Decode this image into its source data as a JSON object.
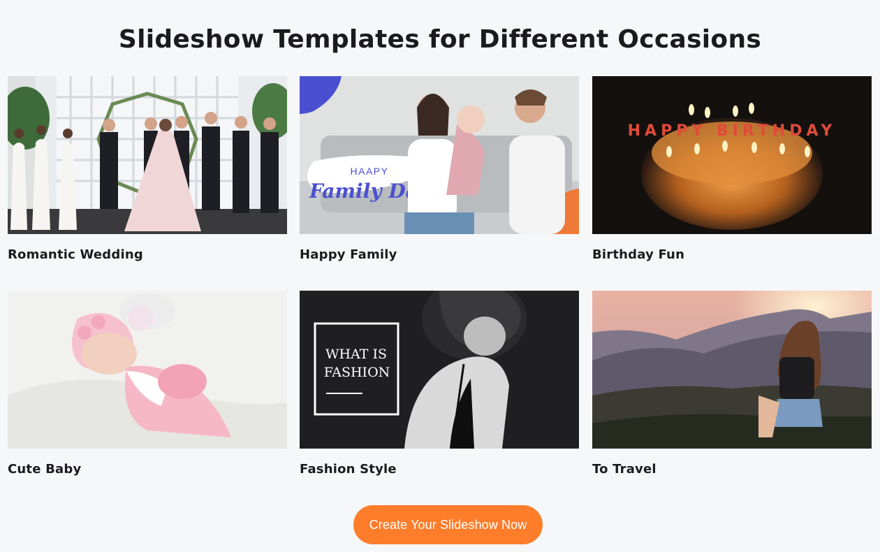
{
  "page": {
    "title": "Slideshow Templates for Different Occasions"
  },
  "templates": [
    {
      "label": "Romantic Wedding",
      "icon": "wedding-photo"
    },
    {
      "label": "Happy Family",
      "icon": "family-photo",
      "overlay_small": "HAAPY",
      "overlay_big": "Family Day"
    },
    {
      "label": "Birthday Fun",
      "icon": "birthday-cake-photo",
      "cake_text": "HAPPY BIRTHDAY"
    },
    {
      "label": "Cute Baby",
      "icon": "sleeping-baby-photo"
    },
    {
      "label": "Fashion Style",
      "icon": "fashion-photo",
      "overlay_line1": "WHAT IS",
      "overlay_line2": "FASHION"
    },
    {
      "label": "To Travel",
      "icon": "mountain-travel-photo"
    }
  ],
  "cta": {
    "label": "Create Your Slideshow Now"
  },
  "colors": {
    "background": "#f6f7f9",
    "accent": "#fd7d2b",
    "family_accent": "#4a4fd1"
  }
}
